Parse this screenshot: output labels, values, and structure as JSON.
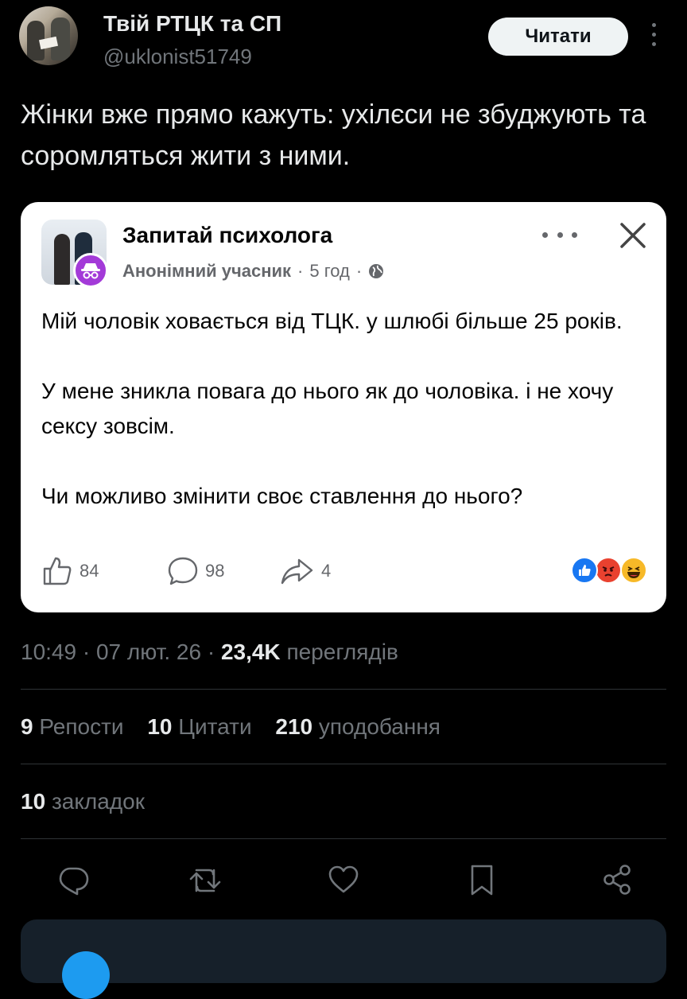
{
  "author": {
    "name": "Твій РТЦК та СП",
    "handle": "@uklonist51749"
  },
  "follow_label": "Читати",
  "tweet_text": "Жінки вже прямо кажуть: ухілєси не збуджують та соромляться жити з ними.",
  "embedded_post": {
    "group_name": "Запитай психолога",
    "author": "Анонімний учасник",
    "separator": "·",
    "time": "5 год",
    "paragraphs": [
      "Мій чоловік ховається від ТЦК. у шлюбі більше 25 років.",
      "У мене зникла повага до нього як до чоловіка. і не хочу сексу зовсім.",
      "Чи можливо змінити своє ставлення до нього?"
    ],
    "likes": "84",
    "comments": "98",
    "shares": "4",
    "reaction_icons": [
      "like-reaction-icon",
      "angry-reaction-icon",
      "haha-reaction-icon"
    ]
  },
  "timestamp": {
    "time": "10:49",
    "sep1": "·",
    "date": "07 лют. 26",
    "sep2": "·",
    "views": "23,4K",
    "views_label": "переглядів"
  },
  "stats": {
    "reposts": "9",
    "reposts_label": "Репости",
    "quotes": "10",
    "quotes_label": "Цитати",
    "likes": "210",
    "likes_label": "уподобання"
  },
  "bookmarks": {
    "count": "10",
    "label": "закладок"
  },
  "actions": [
    "reply-icon",
    "retweet-icon",
    "like-icon",
    "bookmark-icon",
    "share-icon"
  ],
  "colors": {
    "background": "#000000",
    "text": "#e7e9ea",
    "muted": "#71767b",
    "anon_badge": "#a33ad8",
    "fb_like": "#1877f2",
    "accent": "#1d9bf0"
  }
}
